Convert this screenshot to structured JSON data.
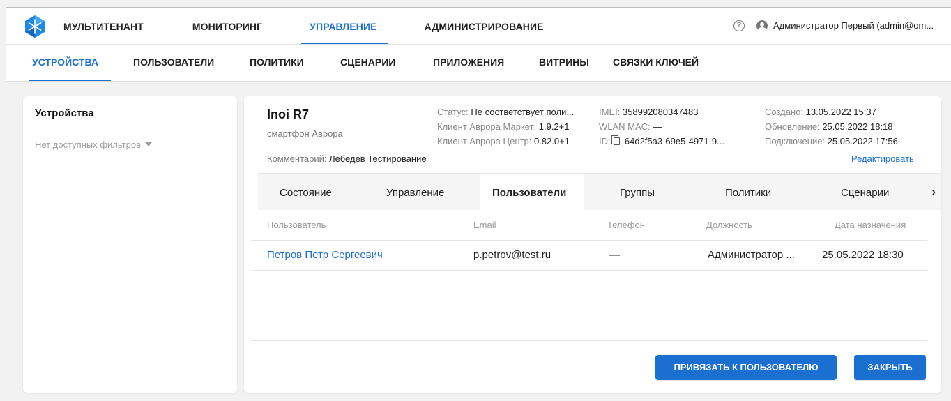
{
  "colors": {
    "accent": "#1a6fd0",
    "background": "#f2f2f2"
  },
  "header": {
    "logo_icon": "snowflake-logo-icon",
    "nav": [
      "МУЛЬТИТЕНАНТ",
      "МОНИТОРИНГ",
      "УПРАВЛЕНИЕ",
      "АДМИНИСТРИРОВАНИЕ"
    ],
    "active_nav": "УПРАВЛЕНИЕ",
    "help_icon": "help-circle-icon",
    "help_glyph": "?",
    "user_icon": "account-icon",
    "user": "Администратор Первый (admin@om..."
  },
  "subnav": {
    "items": [
      "УСТРОЙСТВА",
      "ПОЛЬЗОВАТЕЛИ",
      "ПОЛИТИКИ",
      "СЦЕНАРИИ",
      "ПРИЛОЖЕНИЯ",
      "ВИТРИНЫ",
      "СВЯЗКИ КЛЮЧЕЙ"
    ],
    "active": "УСТРОЙСТВА"
  },
  "sidebar": {
    "title": "Устройства",
    "filters": "Нет доступных фильтров"
  },
  "device": {
    "name": "Inoi R7",
    "type": "смартфон Аврора",
    "comment_label": "Комментарий:",
    "comment": "Лебедев Тестирование",
    "status_label": "Статус:",
    "status": "Не соответствует поли...",
    "market_label": "Клиент Аврора Маркет:",
    "market": "1.9.2+1",
    "center_label": "Клиент Аврора Центр:",
    "center": "0.82.0+1",
    "imei_label": "IMEI:",
    "imei": "358992080347483",
    "wlan_label": "WLAN MAC:",
    "wlan": "—",
    "id_label": "ID:",
    "id": "64d2f5a3-69e5-4971-9...",
    "created_label": "Создано:",
    "created": "13.05.2022 15:37",
    "updated_label": "Обновление:",
    "updated": "25.05.2022 18:18",
    "connected_label": "Подключение:",
    "connected": "25.05.2022 17:56",
    "edit": "Редактировать"
  },
  "tabs": {
    "items": [
      "Состояние",
      "Управление",
      "Пользователи",
      "Группы",
      "Политики",
      "Сценарии"
    ],
    "active": "Пользователи",
    "next_icon": "chevron-right-icon",
    "next_glyph": "›"
  },
  "table": {
    "columns": [
      "Пользователь",
      "Email",
      "Телефон",
      "Должность",
      "Дата назначения"
    ],
    "rows": [
      [
        "Петров Петр Сергеевич",
        "p.petrov@test.ru",
        "—",
        "Администратор ...",
        "25.05.2022 18:30"
      ]
    ]
  },
  "actions": {
    "bind": "ПРИВЯЗАТЬ К ПОЛЬЗОВАТЕЛЮ",
    "close": "ЗАКРЫТЬ"
  }
}
